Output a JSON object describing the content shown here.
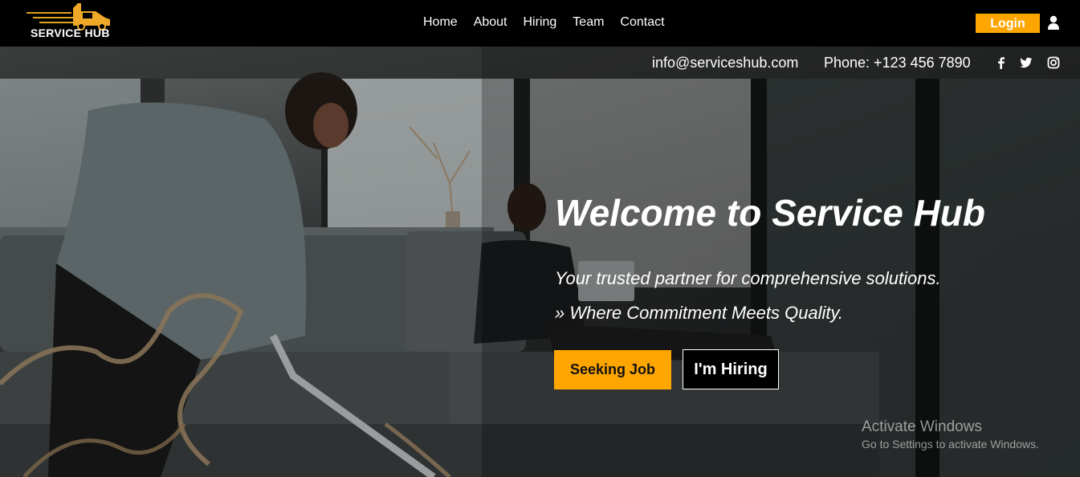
{
  "brand": {
    "name": "SERVICE HUB"
  },
  "nav": {
    "links": [
      "Home",
      "About",
      "Hiring",
      "Team",
      "Contact"
    ],
    "login_label": "Login"
  },
  "contact": {
    "email": "info@serviceshub.com",
    "phone": "Phone: +123 456 7890",
    "social_icons": [
      "facebook-icon",
      "twitter-icon",
      "instagram-icon"
    ]
  },
  "hero": {
    "title": "Welcome to Service Hub",
    "tagline": "Your trusted partner for comprehensive solutions.",
    "motto": "» Where Commitment Meets Quality.",
    "primary_button": "Seeking Job",
    "secondary_button": "I'm Hiring"
  },
  "watermark": {
    "title": "Activate Windows",
    "subtitle": "Go to Settings to activate Windows."
  },
  "colors": {
    "accent": "#ffa500",
    "navbar": "#000000",
    "text": "#ffffff"
  }
}
